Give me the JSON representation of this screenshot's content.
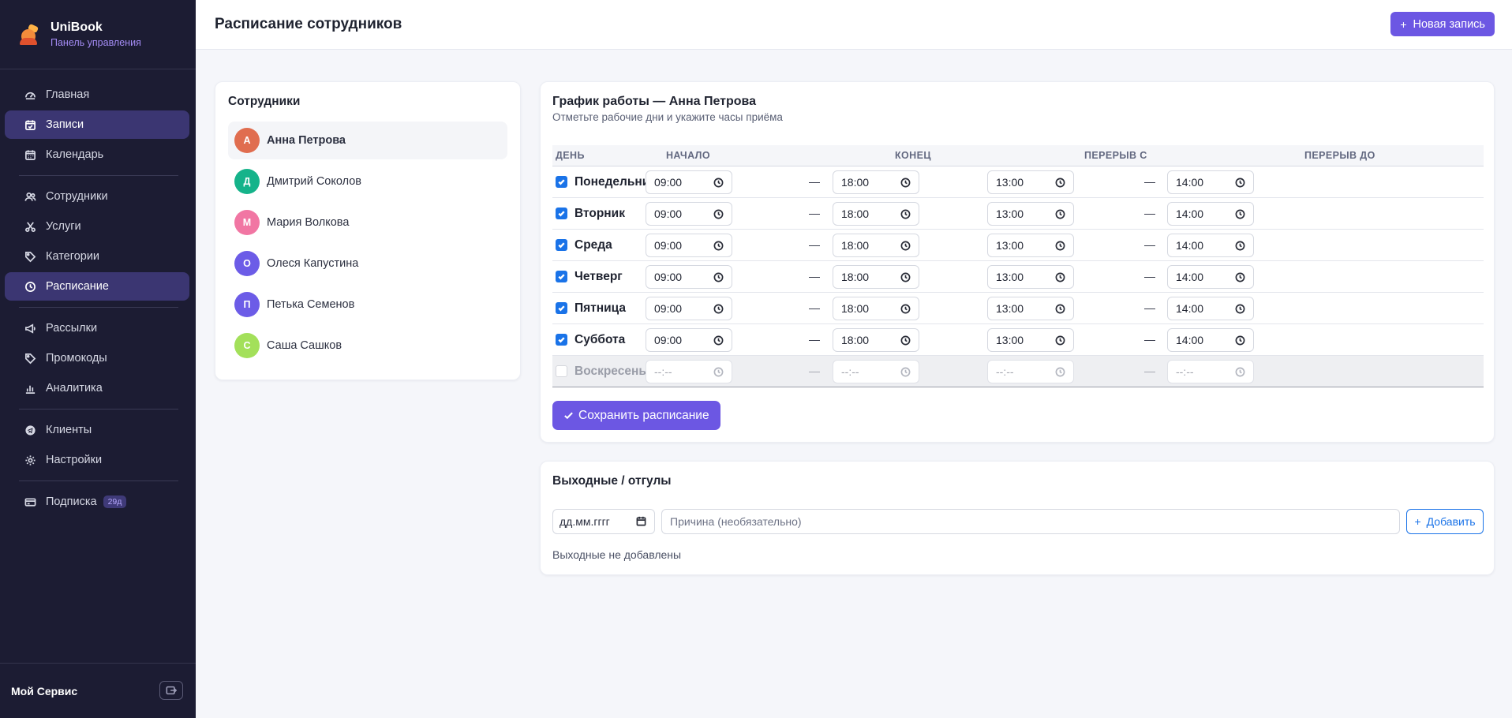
{
  "brand": {
    "name": "UniBook",
    "subtitle": "Панель управления"
  },
  "sidebar": {
    "groups": [
      [
        {
          "label": "Главная",
          "icon": "gauge-icon",
          "active": false
        },
        {
          "label": "Записи",
          "icon": "calendar-check-icon",
          "active": true
        },
        {
          "label": "Календарь",
          "icon": "calendar-grid-icon",
          "active": false
        }
      ],
      [
        {
          "label": "Сотрудники",
          "icon": "people-icon",
          "active": false
        },
        {
          "label": "Услуги",
          "icon": "scissors-icon",
          "active": false
        },
        {
          "label": "Категории",
          "icon": "tag-icon",
          "active": false
        },
        {
          "label": "Расписание",
          "icon": "clock-icon",
          "active": true
        }
      ],
      [
        {
          "label": "Рассылки",
          "icon": "megaphone-icon",
          "active": false
        },
        {
          "label": "Промокоды",
          "icon": "tag-icon",
          "active": false
        },
        {
          "label": "Аналитика",
          "icon": "bar-chart-icon",
          "active": false
        }
      ],
      [
        {
          "label": "Клиенты",
          "icon": "telegram-icon",
          "active": false
        },
        {
          "label": "Настройки",
          "icon": "gear-icon",
          "active": false
        }
      ],
      [
        {
          "label": "Подписка",
          "icon": "credit-card-icon",
          "active": false,
          "badge": "29д"
        }
      ]
    ],
    "footer": {
      "user": "Мой Сервис"
    }
  },
  "header": {
    "title": "Расписание сотрудников",
    "new_button": "Новая запись"
  },
  "employees": {
    "title": "Сотрудники",
    "items": [
      {
        "initial": "А",
        "name": "Анна Петрова",
        "color": "#e06d4f",
        "active": true
      },
      {
        "initial": "Д",
        "name": "Дмитрий Соколов",
        "color": "#15b38a",
        "active": false
      },
      {
        "initial": "М",
        "name": "Мария Волкова",
        "color": "#f176a3",
        "active": false
      },
      {
        "initial": "О",
        "name": "Олеся Капустина",
        "color": "#6c5ce7",
        "active": false
      },
      {
        "initial": "П",
        "name": "Петька Семенов",
        "color": "#6c5ce7",
        "active": false
      },
      {
        "initial": "С",
        "name": "Саша Сашков",
        "color": "#a3e05a",
        "active": false
      }
    ]
  },
  "schedule": {
    "title": "График работы — Анна Петрова",
    "subtitle": "Отметьте рабочие дни и укажите часы приёма",
    "columns": [
      "ДЕНЬ",
      "НАЧАЛО",
      "КОНЕЦ",
      "ПЕРЕРЫВ С",
      "ПЕРЕРЫВ ДО"
    ],
    "separator": "—",
    "rows": [
      {
        "day": "Понедельник",
        "enabled": true,
        "start": "09:00",
        "end": "18:00",
        "break_from": "13:00",
        "break_to": "14:00"
      },
      {
        "day": "Вторник",
        "enabled": true,
        "start": "09:00",
        "end": "18:00",
        "break_from": "13:00",
        "break_to": "14:00"
      },
      {
        "day": "Среда",
        "enabled": true,
        "start": "09:00",
        "end": "18:00",
        "break_from": "13:00",
        "break_to": "14:00"
      },
      {
        "day": "Четверг",
        "enabled": true,
        "start": "09:00",
        "end": "18:00",
        "break_from": "13:00",
        "break_to": "14:00"
      },
      {
        "day": "Пятница",
        "enabled": true,
        "start": "09:00",
        "end": "18:00",
        "break_from": "13:00",
        "break_to": "14:00"
      },
      {
        "day": "Суббота",
        "enabled": true,
        "start": "09:00",
        "end": "18:00",
        "break_from": "13:00",
        "break_to": "14:00"
      },
      {
        "day": "Воскресенье",
        "enabled": false,
        "start": "--:--",
        "end": "--:--",
        "break_from": "--:--",
        "break_to": "--:--"
      }
    ],
    "save_button": "Сохранить расписание"
  },
  "days_off": {
    "title": "Выходные / отгулы",
    "date_placeholder": "дд.мм.гггг",
    "reason_placeholder": "Причина (необязательно)",
    "add_button": "Добавить",
    "empty_text": "Выходные не добавлены"
  },
  "colors": {
    "accent": "#6c57e3",
    "sidebar_bg": "#1c1c33",
    "link_blue": "#1a73e8"
  }
}
